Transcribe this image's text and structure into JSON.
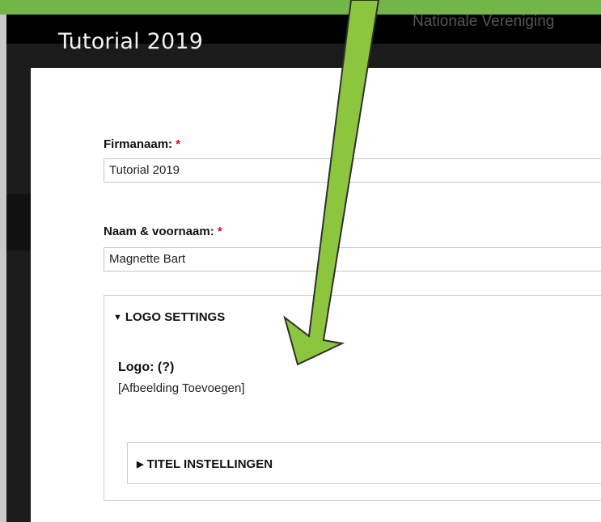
{
  "header": {
    "site_name": "Nationale Vereniging",
    "title": "Tutorial 2019"
  },
  "form": {
    "company": {
      "label": "Firmanaam:",
      "required_mark": "*",
      "value": "Tutorial 2019"
    },
    "name": {
      "label": "Naam & voornaam:",
      "required_mark": "*",
      "value": "Magnette Bart"
    },
    "logo_settings": {
      "legend": "LOGO SETTINGS",
      "expanded": true,
      "logo_label": "Logo: (?)",
      "add_image_link": "[Afbeelding Toevoegen]"
    },
    "title_settings": {
      "legend": "TITEL INSTELLINGEN",
      "expanded": false
    }
  },
  "annotation": {
    "arrow_color": "#8cc63f",
    "arrow_outline": "#2f2f2f"
  },
  "colors": {
    "banner": "#72b64a",
    "required": "#e2001a"
  }
}
